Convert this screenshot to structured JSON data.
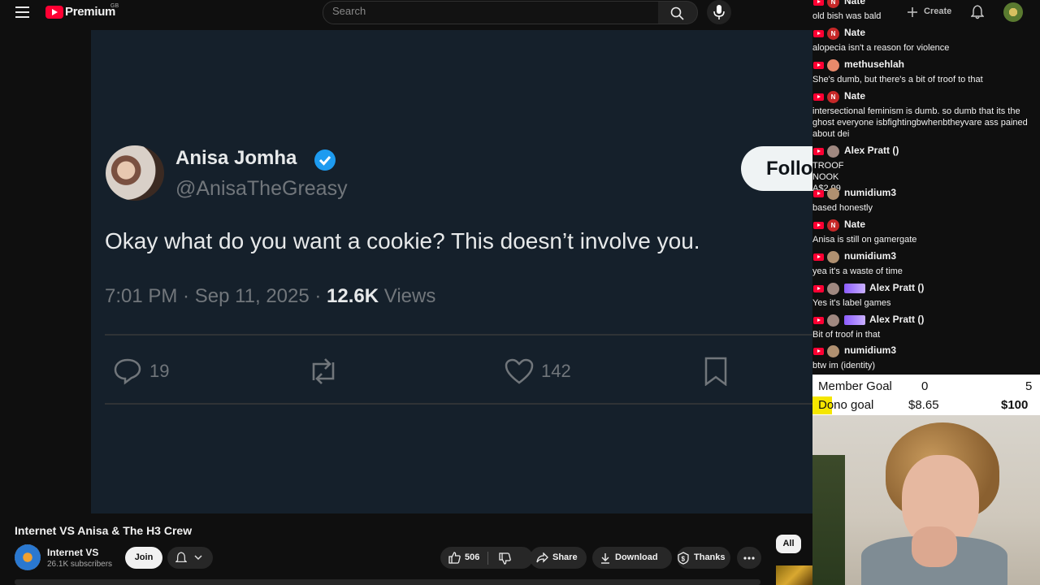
{
  "header": {
    "logo_text": "Premium",
    "logo_region": "GB",
    "search_placeholder": "Search",
    "create_label": "Create"
  },
  "tweet": {
    "name": "Anisa Jomha",
    "handle": "@AnisaTheGreasy",
    "text": "Okay what do you want a cookie? This doesn’t involve you.",
    "time": "7:01 PM · Sep 11, 2025 · ",
    "views_count": "12.6K",
    "views_label": " Views",
    "replies": "19",
    "likes": "142",
    "follow_label": "Follow"
  },
  "video": {
    "title": "Internet VS Anisa & The H3 Crew",
    "channel_name": "Internet VS",
    "subscribers": "26.1K subscribers",
    "join_label": "Join",
    "like_count": "506",
    "share_label": "Share",
    "download_label": "Download",
    "thanks_label": "Thanks",
    "chip_all": "All"
  },
  "chat": [
    {
      "name": "Nate",
      "avatar_letter": "N",
      "avatar_color": "#c62828",
      "message": "old bish was bald"
    },
    {
      "name": "Nate",
      "avatar_letter": "N",
      "avatar_color": "#c62828",
      "message": "alopecia isn't a reason for violence"
    },
    {
      "name": "methusehlah",
      "avatar_letter": "",
      "avatar_color": "#e8896a",
      "message": "She's dumb, but there's a bit of troof to that"
    },
    {
      "name": "Nate",
      "avatar_letter": "N",
      "avatar_color": "#c62828",
      "message": "intersectional feminism is dumb. so dumb that its the ghost everyone isbfightingbwhenbtheyvare ass pained about dei"
    },
    {
      "name": "Alex Pratt ()",
      "avatar_letter": "",
      "avatar_color": "#a08880",
      "message": "TROOF NOOK A$2.99"
    },
    {
      "name": "numidium3",
      "avatar_letter": "",
      "avatar_color": "#b09070",
      "message": "based honestly"
    },
    {
      "name": "Nate",
      "avatar_letter": "N",
      "avatar_color": "#c62828",
      "message": "Anisa is still on gamergate"
    },
    {
      "name": "numidium3",
      "avatar_letter": "",
      "avatar_color": "#b09070",
      "message": "yea it's a waste of time"
    },
    {
      "name": "Alex Pratt ()",
      "avatar_letter": "",
      "avatar_color": "#a08880",
      "message": "Yes it's label games"
    },
    {
      "name": "Alex Pratt ()",
      "avatar_letter": "",
      "avatar_color": "#a08880",
      "message": "Bit of troof in that"
    },
    {
      "name": "numidium3",
      "avatar_letter": "",
      "avatar_color": "#b09070",
      "message": "btw im (identity)"
    }
  ],
  "goals": {
    "member_label": "Member Goal",
    "member_current": "0",
    "member_target": "5",
    "dono_label": "Dono goal",
    "dono_current": "$8.65",
    "dono_target": "$100",
    "dono_progress": 0.0865
  },
  "colors": {
    "accent_red": "#ff0033",
    "tweet_bg": "#15202b",
    "verified_blue": "#1d9bf0",
    "dono_fill": "#f5e600"
  }
}
